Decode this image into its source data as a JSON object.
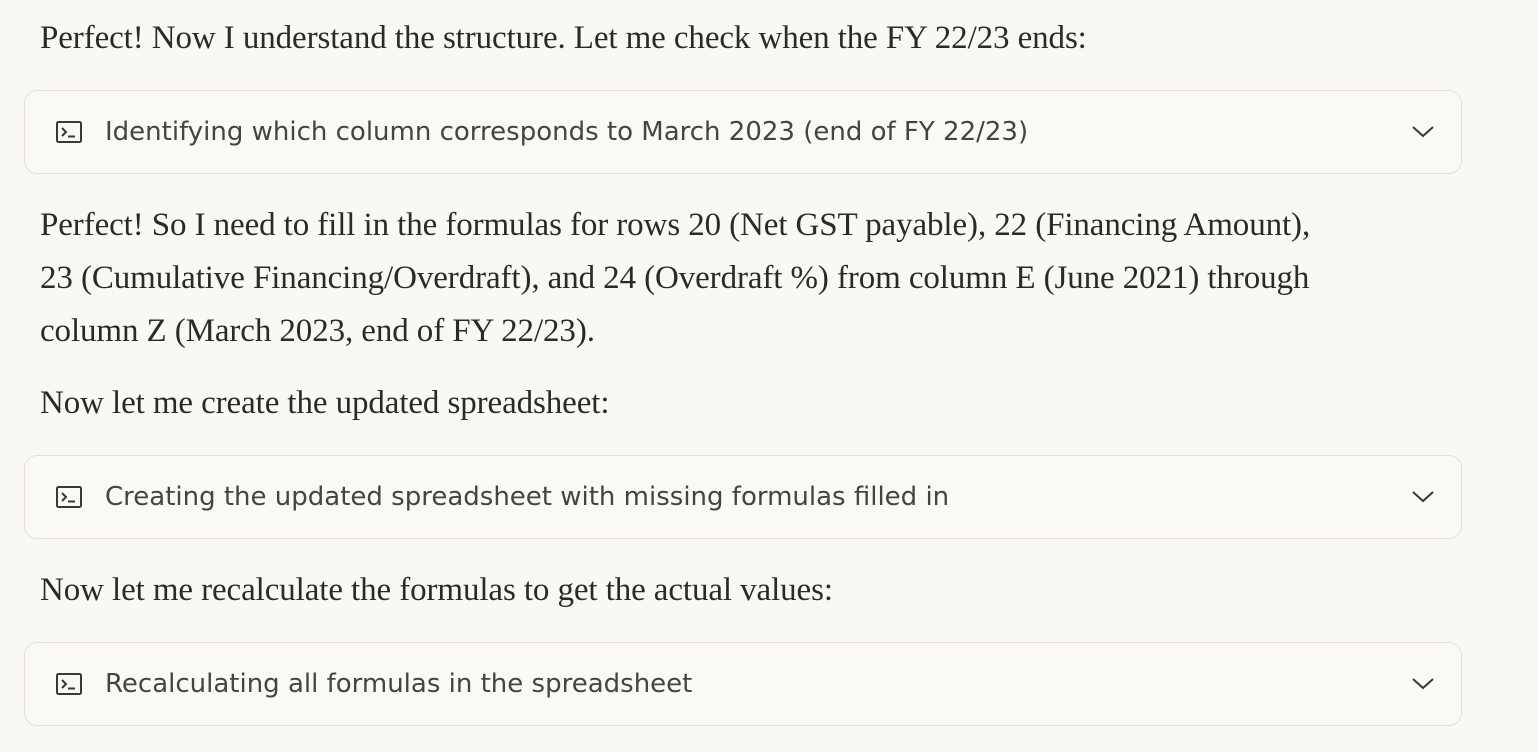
{
  "messages": [
    {
      "type": "text",
      "text": "Perfect! Now I understand the structure. Let me check when the FY 22/23 ends:"
    },
    {
      "type": "tool",
      "label": "Identifying which column corresponds to March 2023 (end of FY 22/23)",
      "icon": "terminal-icon",
      "expand_icon": "chevron-down-icon"
    },
    {
      "type": "text",
      "text": "Perfect! So I need to fill in the formulas for rows 20 (Net GST payable), 22 (Financing Amount), 23 (Cumulative Financing/Overdraft), and 24 (Overdraft %) from column E (June 2021) through column Z (March 2023, end of FY 22/23)."
    },
    {
      "type": "text",
      "text": "Now let me create the updated spreadsheet:"
    },
    {
      "type": "tool",
      "label": "Creating the updated spreadsheet with missing formulas filled in",
      "icon": "terminal-icon",
      "expand_icon": "chevron-down-icon"
    },
    {
      "type": "text",
      "text": "Now let me recalculate the formulas to get the actual values:"
    },
    {
      "type": "tool",
      "label": "Recalculating all formulas in the spreadsheet",
      "icon": "terminal-icon",
      "expand_icon": "chevron-down-icon"
    }
  ],
  "colors": {
    "background": "#f9f8f5",
    "text": "#2b2a26",
    "card_border": "#e3e0d7",
    "card_text": "#45443f"
  }
}
